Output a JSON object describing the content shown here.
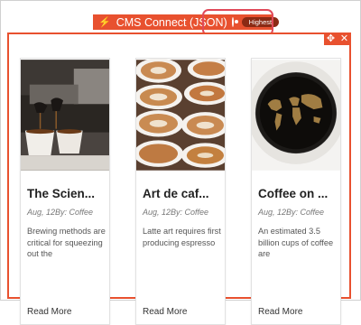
{
  "tab": {
    "title": "CMS Connect (JSON)",
    "badge": "Highest"
  },
  "colors": {
    "accent": "#e8512f",
    "badge": "#8a2a14",
    "highlight": "#e04a5a"
  },
  "toolbar": {
    "move_icon": "✥",
    "close_icon": "✕"
  },
  "cards": [
    {
      "title": "The Scien...",
      "meta": "Aug, 12By: Coffee",
      "excerpt": "Brewing methods are critical for squeezing out the",
      "read_more": "Read More",
      "image": "espresso-machine-pouring"
    },
    {
      "title": "Art de caf...",
      "meta": "Aug, 12By: Coffee",
      "excerpt": "Latte art requires first producing espresso",
      "read_more": "Read More",
      "image": "latte-art-cups"
    },
    {
      "title": "Coffee on ...",
      "meta": "Aug, 12By: Coffee",
      "excerpt": "An estimated 3.5 billion cups of coffee are",
      "read_more": "Read More",
      "image": "coffee-world-map"
    }
  ]
}
